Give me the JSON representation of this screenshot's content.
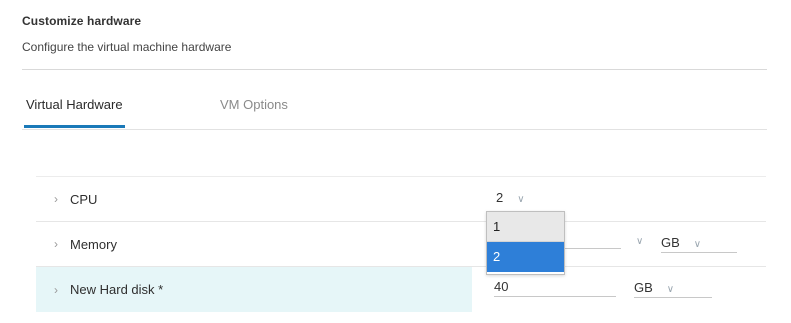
{
  "header": {
    "title": "Customize hardware",
    "subtitle": "Configure the virtual machine hardware"
  },
  "tabs": [
    {
      "label": "Virtual Hardware",
      "active": true
    },
    {
      "label": "VM Options",
      "active": false
    }
  ],
  "hardware": {
    "cpu": {
      "label": "CPU",
      "value": "2"
    },
    "memory": {
      "label": "Memory",
      "unit": "GB"
    },
    "hard_disk": {
      "label": "New Hard disk *",
      "value": "40",
      "unit": "GB"
    }
  },
  "cpu_dropdown": {
    "options": [
      "1",
      "2"
    ],
    "highlighted": "2"
  },
  "icons": {
    "expand": "chevron-right-icon",
    "dropdown": "chevron-down-icon"
  },
  "colors": {
    "accent": "#1a79b8",
    "selected_option": "#2e7fd8",
    "highlight_row": "#e6f6f8"
  }
}
